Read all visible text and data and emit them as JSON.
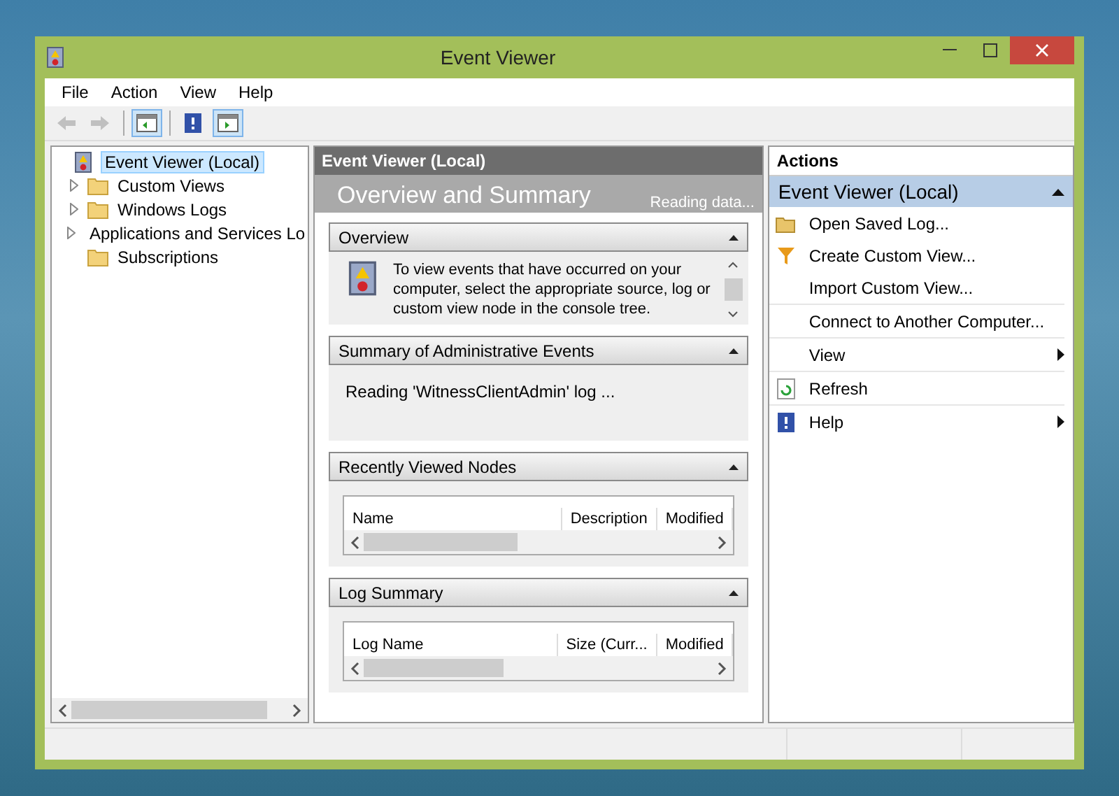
{
  "window": {
    "title": "Event Viewer"
  },
  "menu": [
    "File",
    "Action",
    "View",
    "Help"
  ],
  "toolbar": [
    {
      "kind": "back",
      "disabled": true,
      "pressed": false
    },
    {
      "kind": "forward",
      "disabled": true,
      "pressed": false
    },
    {
      "kind": "tree-pane",
      "disabled": false,
      "pressed": true
    },
    {
      "kind": "help",
      "disabled": false,
      "pressed": false
    },
    {
      "kind": "action-pane",
      "disabled": false,
      "pressed": true
    }
  ],
  "tree": [
    {
      "label": "Event Viewer (Local)",
      "selected": true,
      "expander": false,
      "children": [
        {
          "label": "Custom Views",
          "selected": false,
          "expander": true
        },
        {
          "label": "Windows Logs",
          "selected": false,
          "expander": true
        },
        {
          "label": "Applications and Services Lo",
          "selected": false,
          "expander": true
        },
        {
          "label": "Subscriptions",
          "selected": false,
          "expander": false
        }
      ]
    }
  ],
  "center": {
    "header": "Event Viewer (Local)",
    "title": "Overview and Summary",
    "status": "Reading data...",
    "sections": [
      {
        "kind": "info",
        "title": "Overview",
        "text": "To view events that have occurred on your computer, select the appropriate source, log or custom view node in the console tree."
      },
      {
        "kind": "message",
        "title": "Summary of Administrative Events",
        "text": "Reading 'WitnessClientAdmin' log ..."
      },
      {
        "kind": "table",
        "title": "Recently Viewed Nodes",
        "columns": [
          "Name",
          "Description",
          "Modified"
        ]
      },
      {
        "kind": "table",
        "title": "Log Summary",
        "columns": [
          "Log Name",
          "Size (Curr...",
          "Modified"
        ]
      }
    ]
  },
  "actions": {
    "title": "Actions",
    "group": "Event Viewer (Local)",
    "items": [
      {
        "kind": "open",
        "label": "Open Saved Log...",
        "submenu": false,
        "divider": false
      },
      {
        "kind": "filter",
        "label": "Create Custom View...",
        "submenu": false,
        "divider": false
      },
      {
        "kind": "none",
        "label": "Import Custom View...",
        "submenu": false,
        "divider": true
      },
      {
        "kind": "none",
        "label": "Connect to Another Computer...",
        "submenu": false,
        "divider": true
      },
      {
        "kind": "none",
        "label": "View",
        "submenu": true,
        "divider": true
      },
      {
        "kind": "refresh",
        "label": "Refresh",
        "submenu": false,
        "divider": true
      },
      {
        "kind": "help",
        "label": "Help",
        "submenu": true,
        "divider": false
      }
    ]
  }
}
